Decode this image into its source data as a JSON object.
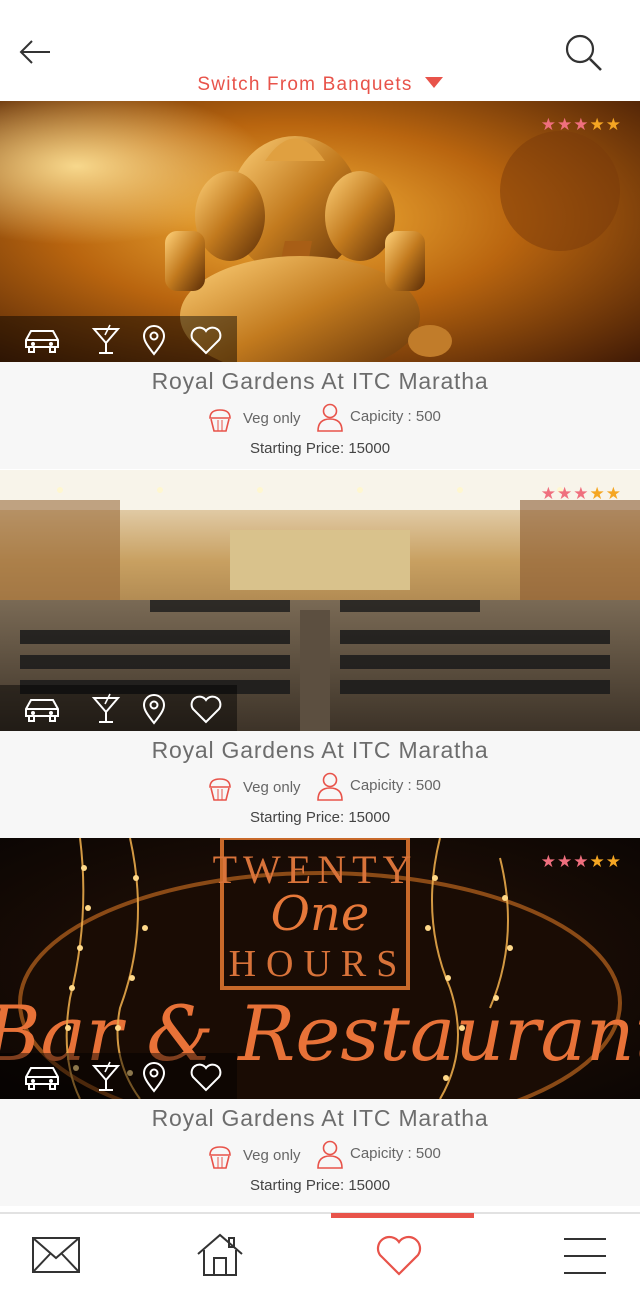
{
  "header": {
    "switch_label": "Switch From Banquets",
    "back_icon": "arrow-left-icon",
    "search_icon": "search-icon"
  },
  "colors": {
    "accent": "#e8534a",
    "star_pink": "#ef6f7e",
    "star_gold": "#f5a623",
    "info_bg": "#f7f7f7",
    "text_gray": "#6d6d6d"
  },
  "venues": [
    {
      "name": "Royal Gardens At ITC Maratha",
      "food": "Veg only",
      "capacity": "Capicity : 500",
      "price": "Starting Price: 15000",
      "rating": 5,
      "image": "golden-ganesha-idol",
      "amenity_icons": [
        "car-icon",
        "cocktail-icon",
        "location-pin-icon",
        "heart-icon"
      ]
    },
    {
      "name": "Royal Gardens At ITC Maratha",
      "food": "Veg only",
      "capacity": "Capicity : 500",
      "price": "Starting Price: 15000",
      "rating": 5,
      "image": "banquet-hall-with-chairs",
      "amenity_icons": [
        "car-icon",
        "cocktail-icon",
        "location-pin-icon",
        "heart-icon"
      ]
    },
    {
      "name": "Royal Gardens At ITC Maratha",
      "food": "Veg only",
      "capacity": "Capicity : 500",
      "price": "Starting Price: 15000",
      "rating": 5,
      "image": "bar-restaurant-sign-with-lights",
      "sign_text": [
        "TWENTY",
        "One",
        "HOURS",
        "Bar & Restaurant"
      ],
      "amenity_icons": [
        "car-icon",
        "cocktail-icon",
        "location-pin-icon",
        "heart-icon"
      ]
    }
  ],
  "bottom_nav": [
    {
      "icon": "mail-icon",
      "active": false
    },
    {
      "icon": "home-icon",
      "active": false
    },
    {
      "icon": "heart-icon",
      "active": true
    },
    {
      "icon": "menu-icon",
      "active": false
    }
  ]
}
